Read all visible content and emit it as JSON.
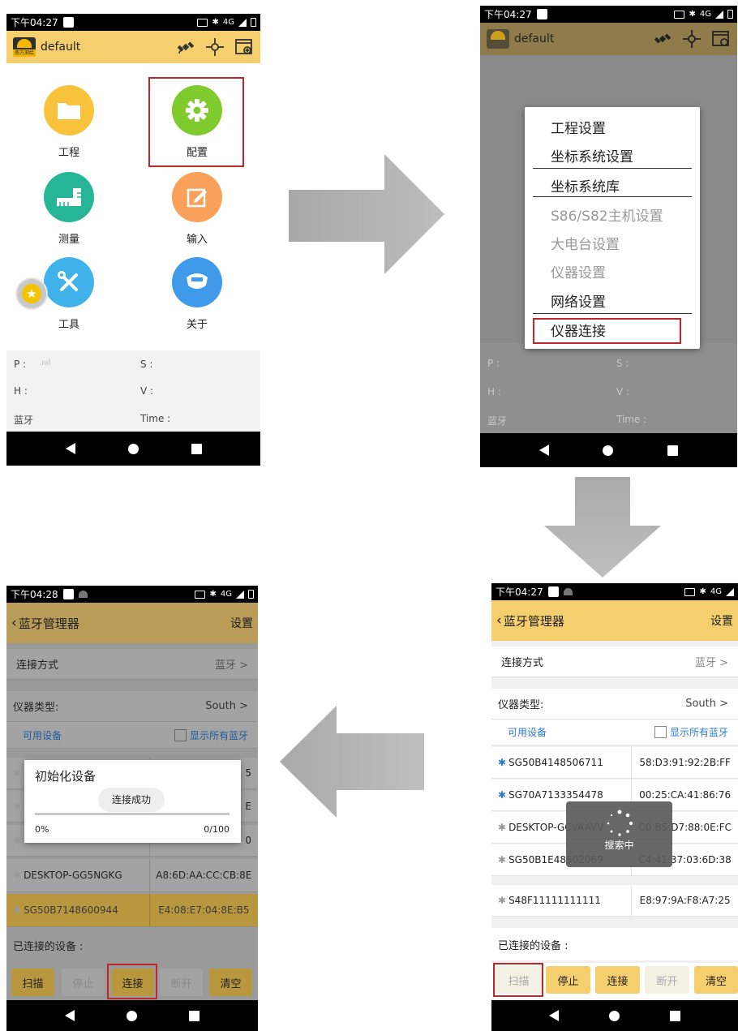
{
  "screen1": {
    "status": {
      "time": "下午04:27",
      "right": "4G"
    },
    "app_title": "default",
    "logo_text": "南方测绘",
    "grid": [
      {
        "label": "工程",
        "icon": "folder-icon",
        "color": "#f8c23b"
      },
      {
        "label": "配置",
        "icon": "gear-icon",
        "color": "#7fcb2e"
      },
      {
        "label": "测量",
        "icon": "ruler-icon",
        "color": "#26b597"
      },
      {
        "label": "输入",
        "icon": "edit-icon",
        "color": "#f9a05a"
      },
      {
        "label": "工具",
        "icon": "tools-icon",
        "color": "#3fb2ec"
      },
      {
        "label": "关于",
        "icon": "receiver-icon",
        "color": "#3f9bea"
      }
    ],
    "info": {
      "p": "P :",
      "s": "S :",
      "h": "H :",
      "v": "V :",
      "bt": "蓝牙",
      "time": "Time :"
    }
  },
  "screen2": {
    "status": {
      "time": "下午04:27",
      "right": "4G"
    },
    "app_title": "default",
    "menu": [
      {
        "label": "工程设置",
        "enabled": true
      },
      {
        "label": "坐标系统设置",
        "enabled": true
      },
      {
        "label": "坐标系统库",
        "enabled": true
      },
      {
        "label": "S86/S82主机设置",
        "enabled": false
      },
      {
        "label": "大电台设置",
        "enabled": false
      },
      {
        "label": "仪器设置",
        "enabled": false
      },
      {
        "label": "网络设置",
        "enabled": true
      },
      {
        "label": "仪器连接",
        "enabled": true
      }
    ],
    "info": {
      "p": "P :",
      "s": "S :",
      "h": "H :",
      "v": "V :",
      "bt": "蓝牙",
      "time": "Time :"
    }
  },
  "screen3": {
    "status": {
      "time": "下午04:27",
      "right": "4G"
    },
    "title": "蓝牙管理器",
    "settings": "设置",
    "conn_method_label": "连接方式",
    "conn_method_value": "蓝牙 >",
    "instr_type_label": "仪器类型:",
    "instr_type_value": "South >",
    "available": "可用设备",
    "show_all": "显示所有蓝牙",
    "devices": [
      {
        "name": "SG50B4148506711",
        "mac": "58:D3:91:92:2B:FF",
        "blue": true
      },
      {
        "name": "SG70A7133354478",
        "mac": "00:25:CA:41:86:76",
        "blue": true
      },
      {
        "name": "DESKTOP-GCVAAVV",
        "mac": "C0:B5:D7:88:0E:FC",
        "blue": false
      },
      {
        "name": "SG50B1E48502069",
        "mac": "C4:41:37:03:6D:38",
        "blue": false
      },
      {
        "name": "S48F11111111111",
        "mac": "E8:97:9A:F8:A7:25",
        "blue": false
      }
    ],
    "searching": "搜索中",
    "connected_label": "已连接的设备 :",
    "buttons": [
      "扫描",
      "停止",
      "连接",
      "断开",
      "清空"
    ]
  },
  "screen4": {
    "status": {
      "time": "下午04:28",
      "right": "4G"
    },
    "title": "蓝牙管理器",
    "settings": "设置",
    "conn_method_label": "连接方式",
    "conn_method_value": "蓝牙 >",
    "instr_type_label": "仪器类型:",
    "instr_type_value": "South >",
    "available": "可用设备",
    "show_all": "显示所有蓝牙",
    "hidden_rows": [
      "5",
      "E",
      "0"
    ],
    "devices": [
      {
        "name": "DESKTOP-GG5NGKG",
        "mac": "A8:6D:AA:CC:CB:8E"
      },
      {
        "name": "SG50B7148600944",
        "mac": "E4:08:E7:04:8E:B5"
      }
    ],
    "dialog": {
      "title": "初始化设备",
      "toast": "连接成功",
      "percent": "0%",
      "count": "0/100",
      "progress": 0
    },
    "connected_label": "已连接的设备 :",
    "buttons": [
      "扫描",
      "停止",
      "连接",
      "断开",
      "清空"
    ]
  }
}
